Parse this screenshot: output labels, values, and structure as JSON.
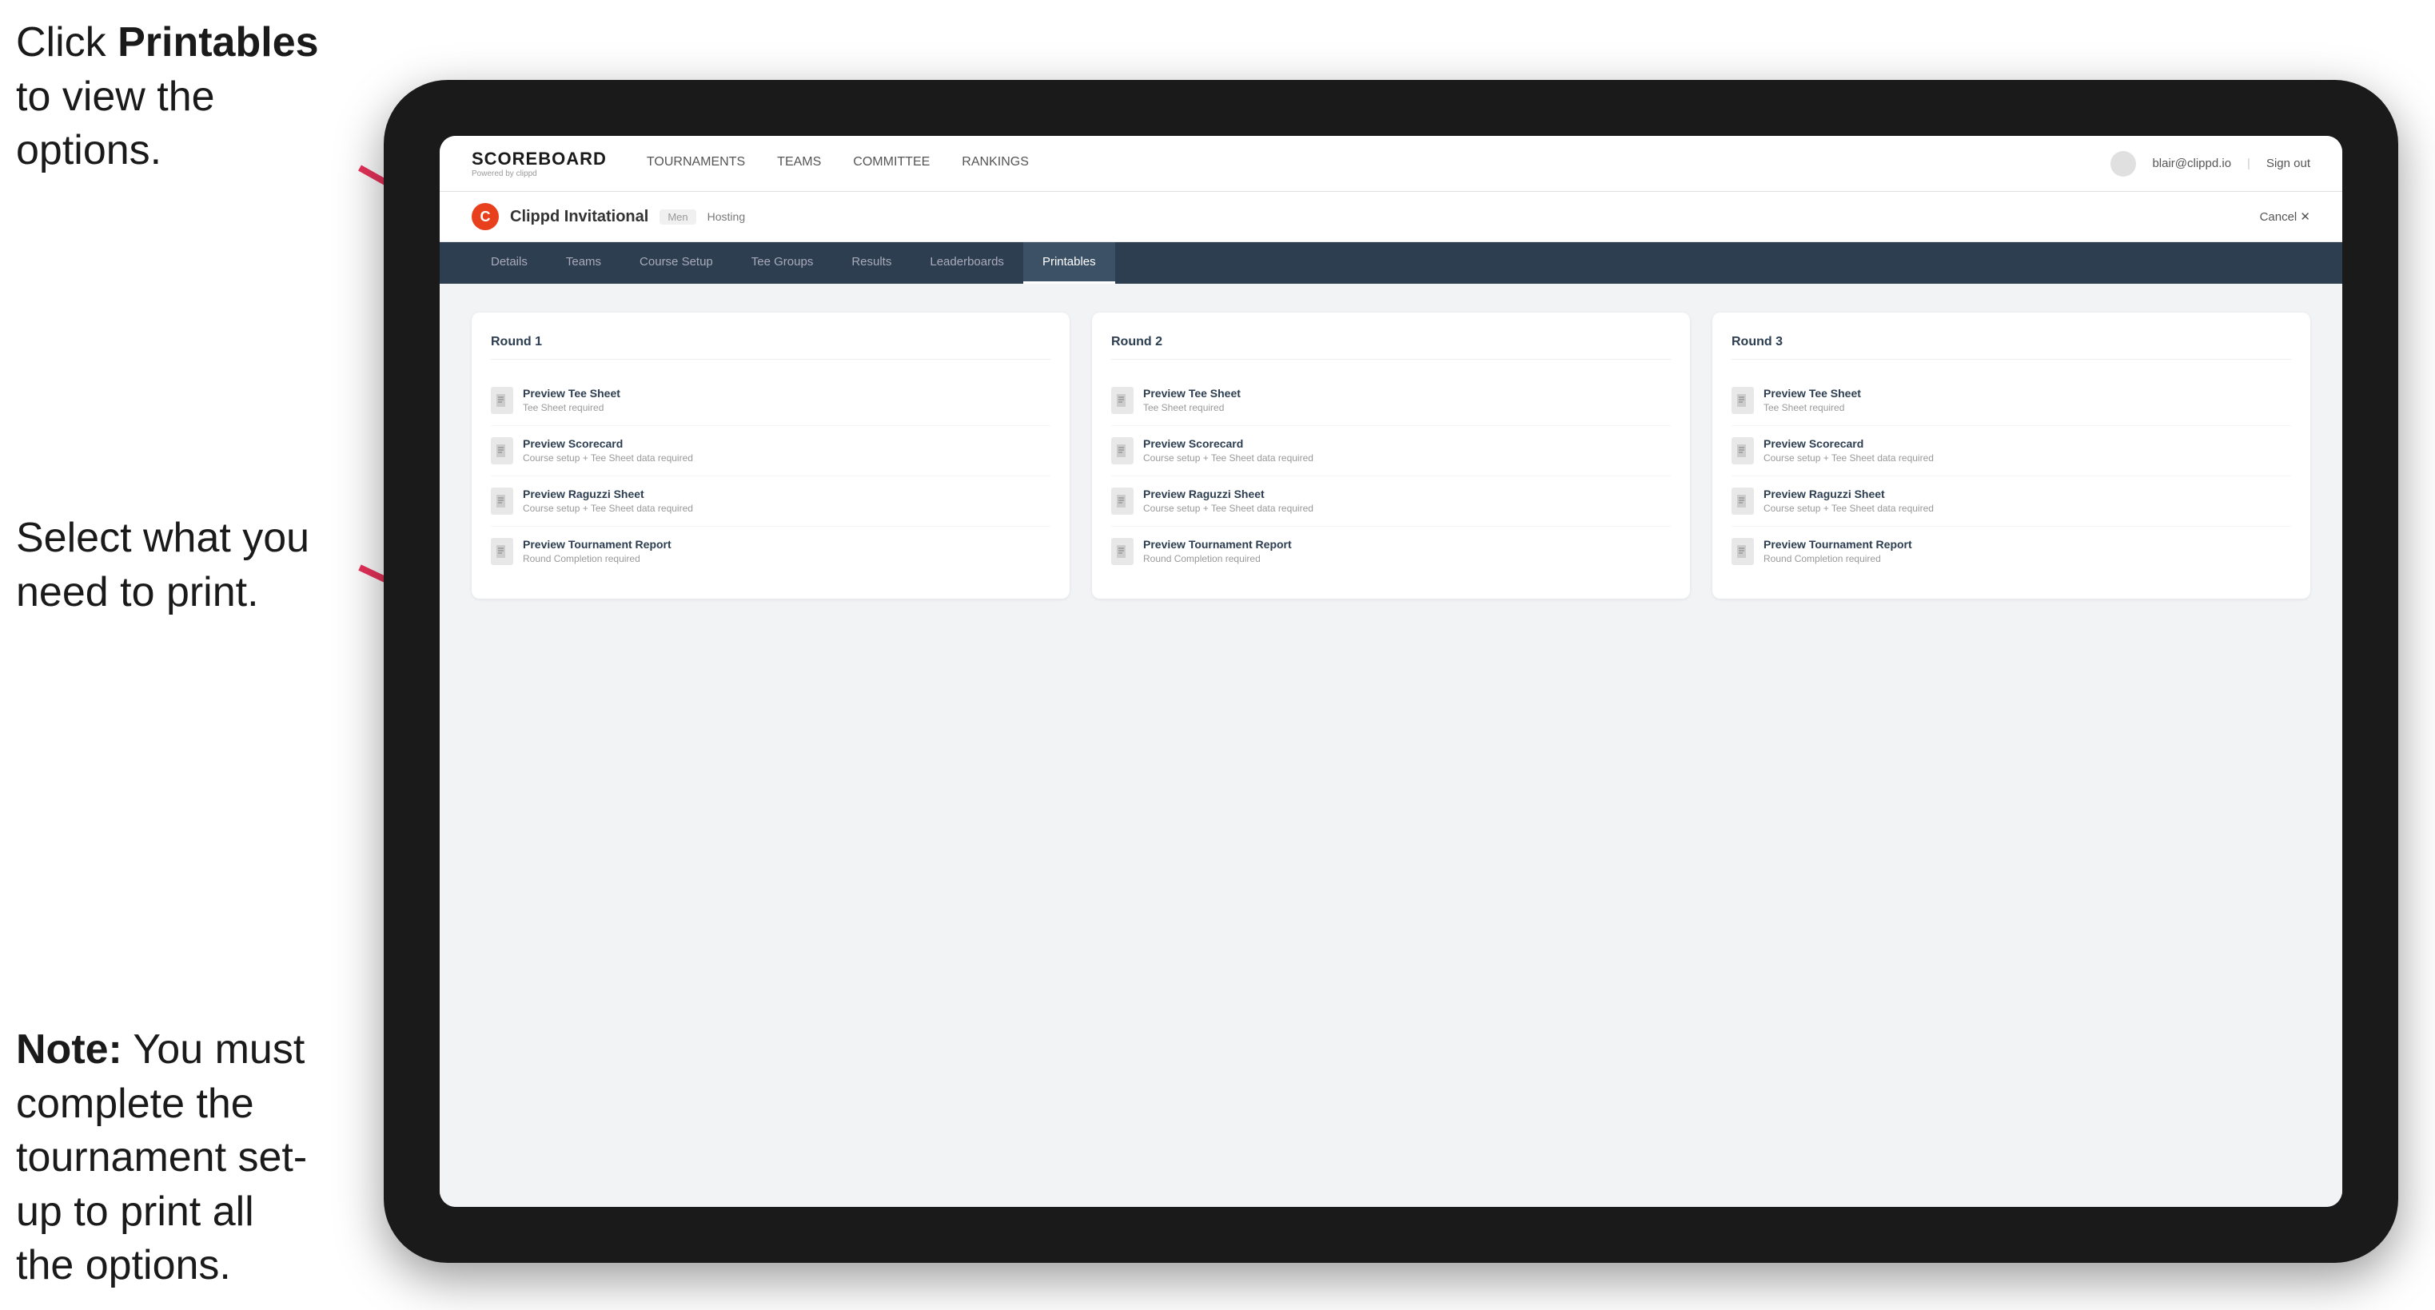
{
  "annotations": {
    "top": "Click Printables to view the options.",
    "top_bold": "Printables",
    "middle": "Select what you need to print.",
    "bottom_prefix": "Note:",
    "bottom_text": " You must complete the tournament set-up to print all the options."
  },
  "nav": {
    "logo_title": "SCOREBOARD",
    "logo_sub": "Powered by clippd",
    "menu_items": [
      "TOURNAMENTS",
      "TEAMS",
      "COMMITTEE",
      "RANKINGS"
    ],
    "user_email": "blair@clippd.io",
    "sign_out": "Sign out",
    "pipe": "|"
  },
  "tournament": {
    "logo_letter": "C",
    "name": "Clippd Invitational",
    "badge": "Men",
    "status": "Hosting",
    "cancel": "Cancel  ✕"
  },
  "tabs": [
    {
      "label": "Details",
      "active": false
    },
    {
      "label": "Teams",
      "active": false
    },
    {
      "label": "Course Setup",
      "active": false
    },
    {
      "label": "Tee Groups",
      "active": false
    },
    {
      "label": "Results",
      "active": false
    },
    {
      "label": "Leaderboards",
      "active": false
    },
    {
      "label": "Printables",
      "active": true
    }
  ],
  "rounds": [
    {
      "title": "Round 1",
      "items": [
        {
          "name": "Preview Tee Sheet",
          "req": "Tee Sheet required"
        },
        {
          "name": "Preview Scorecard",
          "req": "Course setup + Tee Sheet data required"
        },
        {
          "name": "Preview Raguzzi Sheet",
          "req": "Course setup + Tee Sheet data required"
        },
        {
          "name": "Preview Tournament Report",
          "req": "Round Completion required"
        }
      ]
    },
    {
      "title": "Round 2",
      "items": [
        {
          "name": "Preview Tee Sheet",
          "req": "Tee Sheet required"
        },
        {
          "name": "Preview Scorecard",
          "req": "Course setup + Tee Sheet data required"
        },
        {
          "name": "Preview Raguzzi Sheet",
          "req": "Course setup + Tee Sheet data required"
        },
        {
          "name": "Preview Tournament Report",
          "req": "Round Completion required"
        }
      ]
    },
    {
      "title": "Round 3",
      "items": [
        {
          "name": "Preview Tee Sheet",
          "req": "Tee Sheet required"
        },
        {
          "name": "Preview Scorecard",
          "req": "Course setup + Tee Sheet data required"
        },
        {
          "name": "Preview Raguzzi Sheet",
          "req": "Course setup + Tee Sheet data required"
        },
        {
          "name": "Preview Tournament Report",
          "req": "Round Completion required"
        }
      ]
    }
  ]
}
